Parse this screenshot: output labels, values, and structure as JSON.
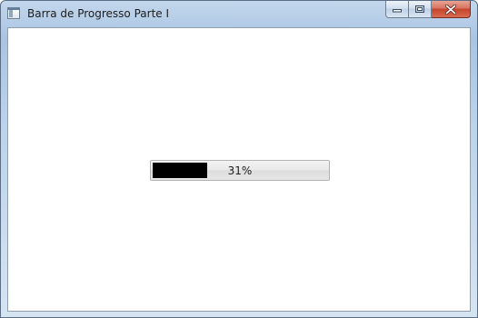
{
  "window": {
    "title": "Barra de Progresso Parte I",
    "app_icon": "window-app-icon",
    "controls": {
      "minimize_icon": "minimize-icon",
      "maximize_icon": "maximize-icon",
      "close_icon": "close-icon"
    }
  },
  "progress": {
    "value": 31,
    "max": 100,
    "label": "31%",
    "fill_color": "#000000"
  }
}
